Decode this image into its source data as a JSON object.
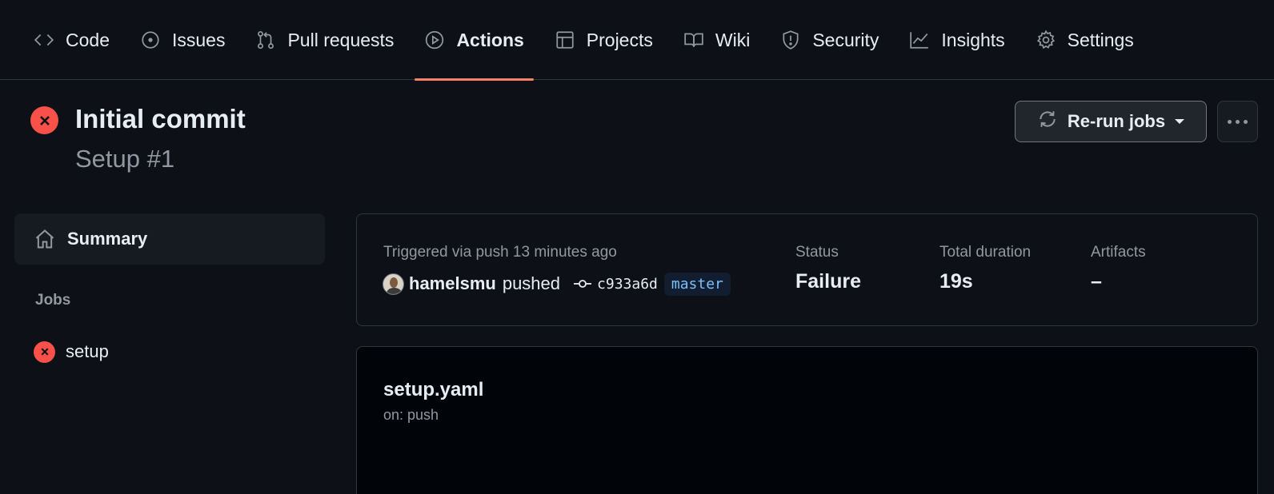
{
  "nav": {
    "tabs": [
      {
        "label": "Code",
        "icon": "code-icon"
      },
      {
        "label": "Issues",
        "icon": "issue-opened-icon"
      },
      {
        "label": "Pull requests",
        "icon": "git-pull-request-icon"
      },
      {
        "label": "Actions",
        "icon": "play-icon",
        "active": true
      },
      {
        "label": "Projects",
        "icon": "table-icon"
      },
      {
        "label": "Wiki",
        "icon": "book-icon"
      },
      {
        "label": "Security",
        "icon": "shield-icon"
      },
      {
        "label": "Insights",
        "icon": "graph-icon"
      },
      {
        "label": "Settings",
        "icon": "gear-icon"
      }
    ],
    "active_underline_color": "#f78166"
  },
  "header": {
    "title": "Initial commit",
    "subtitle": "Setup #1",
    "status_icon": "x-circle-fill-icon",
    "status_color": "#f85149",
    "rerun_label": "Re-run jobs"
  },
  "sidebar": {
    "summary_label": "Summary",
    "jobs_heading": "Jobs",
    "jobs": [
      {
        "label": "setup",
        "status": "failure"
      }
    ]
  },
  "summary": {
    "trigger_text": "Triggered via push 13 minutes ago",
    "actor": "hamelsmu",
    "action": "pushed",
    "sha": "c933a6d",
    "branch": "master",
    "status_label": "Status",
    "status_value": "Failure",
    "duration_label": "Total duration",
    "duration_value": "19s",
    "artifacts_label": "Artifacts",
    "artifacts_value": "–"
  },
  "workflow": {
    "name": "setup.yaml",
    "trigger": "on: push"
  }
}
